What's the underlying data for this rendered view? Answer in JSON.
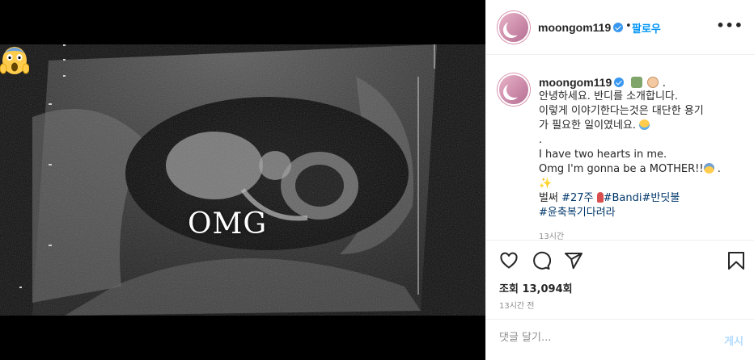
{
  "video": {
    "overlay_text": "OMG",
    "overlay_emoji_icon": "face-screaming-in-fear-icon"
  },
  "header": {
    "username": "moongom119",
    "follow_label": "팔로우",
    "separator": "•",
    "more_icon": "more-options-icon"
  },
  "caption": {
    "username": "moongom119",
    "head_trailing": ".",
    "lines": [
      "안녕하세요. 반디를 소개합니다.",
      "이렇게 이야기한다는것은 대단한 용기",
      "가 필요한 일이였네요.",
      ".",
      "I have two hearts in me.",
      "Omg I'm gonna be a MOTHER!!",
      "벌써",
      "#27주",
      "#Bandi",
      "#반딧불",
      "#윤축복기다려라"
    ],
    "trailing_dot": ".",
    "cut_time": "13시간"
  },
  "actions": {
    "views_label": "조회 13,094회",
    "date": "13시간 전"
  },
  "comment": {
    "placeholder": "댓글 달기...",
    "post_label": "게시"
  },
  "colors": {
    "accent": "#0095f6",
    "verified": "#3897f0",
    "hashtag": "#00376b",
    "muted": "#8e8e8e",
    "border": "#efefef"
  }
}
